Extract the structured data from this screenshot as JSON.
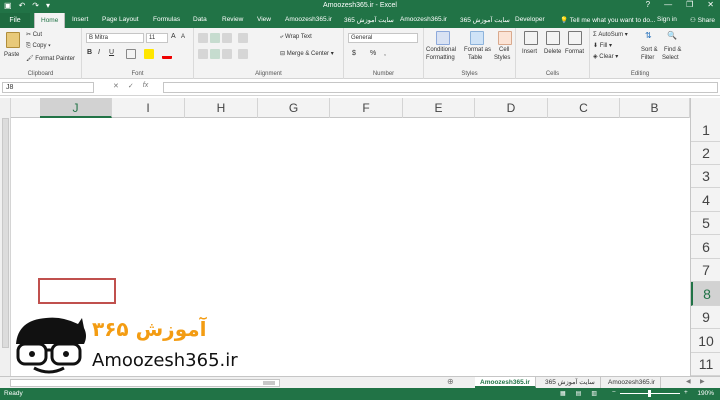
{
  "window": {
    "title": "Amoozesh365.ir - Excel",
    "qat": [
      "save-icon",
      "undo-icon",
      "redo-icon",
      "customize-icon"
    ],
    "controls": [
      "?",
      "—",
      "❐",
      "✕"
    ]
  },
  "tabs": {
    "file": "File",
    "items": [
      "Home",
      "Insert",
      "Page Layout",
      "Formulas",
      "Data",
      "Review",
      "View",
      "Amoozesh365.ir",
      "سایت آموزش 365",
      "Amoozesh365.ir",
      "سایت آموزش 365",
      "Developer"
    ],
    "tell_me": "Tell me what you want to do...",
    "sign_in": "Sign in",
    "share": "Share"
  },
  "ribbon": {
    "clipboard": {
      "label": "Clipboard",
      "paste": "Paste",
      "cut": "Cut",
      "copy": "Copy",
      "format_painter": "Format Painter"
    },
    "font": {
      "label": "Font",
      "name": "B Mitra",
      "size": "11",
      "bold": "B",
      "italic": "I",
      "underline": "U",
      "grow": "A",
      "shrink": "A"
    },
    "alignment": {
      "label": "Alignment",
      "wrap": "Wrap Text",
      "merge": "Merge & Center"
    },
    "number": {
      "label": "Number",
      "format": "General",
      "currency": "$",
      "percent": "%",
      "comma": ","
    },
    "styles": {
      "label": "Styles",
      "conditional": "Conditional",
      "conditional2": "Formatting",
      "format_as": "Format as",
      "format_as2": "Table",
      "cell": "Cell",
      "cell2": "Styles"
    },
    "cells": {
      "label": "Cells",
      "insert": "Insert",
      "delete": "Delete",
      "format": "Format"
    },
    "editing": {
      "label": "Editing",
      "autosum": "AutoSum",
      "fill": "Fill",
      "clear": "Clear",
      "sort": "Sort &",
      "sort2": "Filter",
      "find": "Find &",
      "find2": "Select"
    }
  },
  "formula_bar": {
    "name_box": "J8",
    "cancel": "✕",
    "enter": "✓",
    "fx": "fx",
    "value": ""
  },
  "columns": [
    "J",
    "I",
    "H",
    "G",
    "F",
    "E",
    "D",
    "C",
    "B"
  ],
  "rows": [
    "1",
    "2",
    "3",
    "4",
    "5",
    "6",
    "7",
    "8",
    "9",
    "10",
    "11"
  ],
  "selected": {
    "column": "J",
    "row": "8"
  },
  "logo": {
    "farsi": "آموزش ۳۶۵",
    "latin": "Amoozesh365.ir"
  },
  "sheets": [
    "Amoozesh365.ir",
    "سایت آموزش 365",
    "Amoozesh365.ir"
  ],
  "status": {
    "ready": "Ready",
    "zoom": "190%"
  },
  "colors": {
    "accent": "#217346",
    "selection": "#c0504d"
  }
}
